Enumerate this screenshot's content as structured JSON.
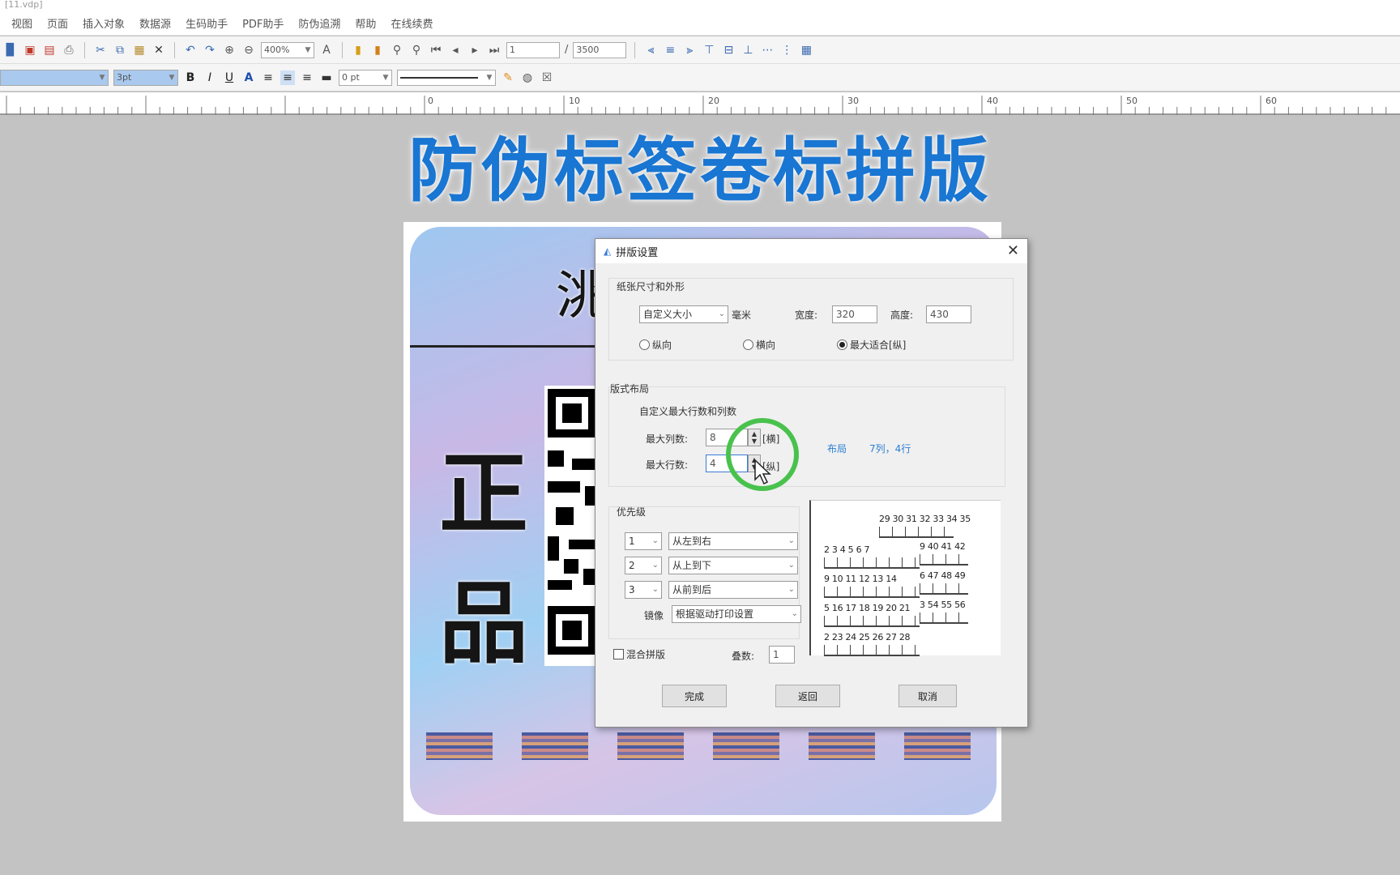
{
  "window": {
    "title": "[11.vdp]"
  },
  "menu": [
    "视图",
    "页面",
    "插入对象",
    "数据源",
    "生码助手",
    "PDF助手",
    "防伪追溯",
    "帮助",
    "在线续费"
  ],
  "toolbar1": {
    "zoom": "400%",
    "page_current": "1",
    "page_sep": "/",
    "page_total": "3500"
  },
  "toolbar2": {
    "font_size": "3pt",
    "line_width": "0 pt"
  },
  "ruler": {
    "ticks": [
      "0",
      "10",
      "20",
      "30",
      "40",
      "50",
      "60"
    ]
  },
  "heading": "防伪标签卷标拼版",
  "label": {
    "top_text": "洮",
    "left_char_1": "正",
    "left_char_2": "品"
  },
  "dialog": {
    "title": "拼版设置",
    "paper_group": {
      "legend": "纸张尺寸和外形",
      "size_select": "自定义大小",
      "unit": "毫米",
      "width_label": "宽度:",
      "width_value": "320",
      "height_label": "高度:",
      "height_value": "430",
      "orientation": [
        {
          "label": "纵向",
          "checked": false
        },
        {
          "label": "横向",
          "checked": false
        },
        {
          "label": "最大适合[纵]",
          "checked": true
        }
      ]
    },
    "layout_group": {
      "legend": "版式布局",
      "subtitle": "自定义最大行数和列数",
      "max_cols_label": "最大列数:",
      "max_cols_value": "8",
      "max_cols_unit": "[横]",
      "max_rows_label": "最大行数:",
      "max_rows_value": "4",
      "max_rows_unit": "[纵]",
      "layout_label": "布局",
      "layout_value": "7列，4行"
    },
    "priority_group": {
      "legend": "优先级",
      "rows": [
        {
          "num": "1",
          "value": "从左到右"
        },
        {
          "num": "2",
          "value": "从上到下"
        },
        {
          "num": "3",
          "value": "从前到后"
        }
      ],
      "mirror_label": "镜像",
      "mirror_value": "根据驱动打印设置"
    },
    "mixed_label": "混合拼版",
    "stack_label": "叠数:",
    "stack_value": "1",
    "preview_rows": [
      "29 30 31 32 33 34 35",
      "2  3  4  5  6  7",
      "9 40 41 42",
      "9 10 11 12 13 14",
      "6 47 48 49",
      "5 16 17 18 19 20 21",
      "3 54 55 56",
      "2 23 24 25 26 27 28"
    ],
    "buttons": {
      "finish": "完成",
      "back": "返回",
      "cancel": "取消"
    }
  },
  "colors": {
    "heading": "#1976d2",
    "highlight_ring": "#49c24d",
    "layout_text": "#2a7fd4"
  }
}
